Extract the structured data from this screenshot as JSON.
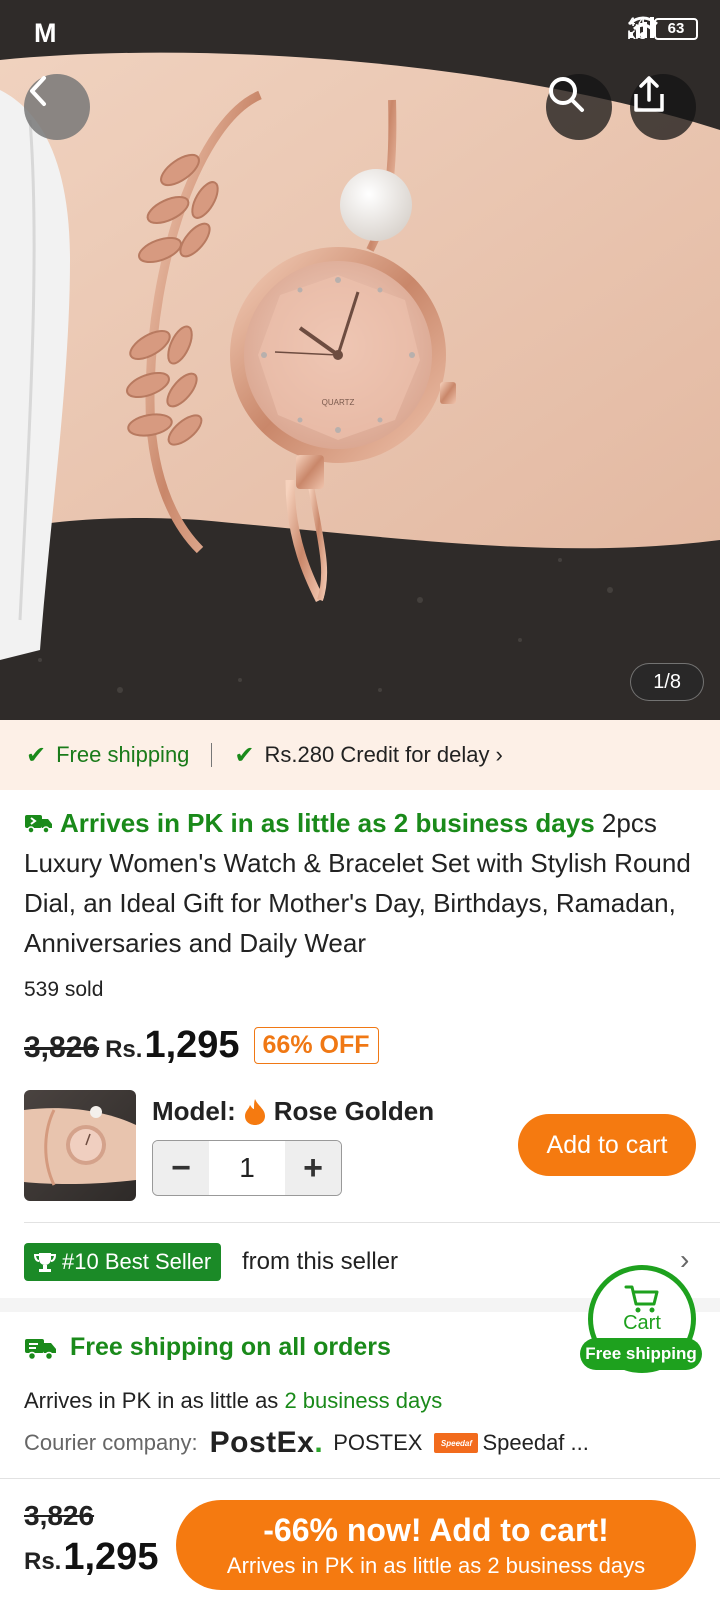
{
  "status_bar": {
    "time": "M",
    "speed_top": "4.4",
    "speed_bottom": "K/s",
    "battery": "63"
  },
  "gallery": {
    "page_indicator": "1/8",
    "watch_dial_text": "QUARTZ"
  },
  "shipping_strip": {
    "free_shipping": "Free shipping",
    "credit": "Rs.280 Credit for delay"
  },
  "product": {
    "arrives_badge": "Arrives in PK in as little as 2 business days",
    "title": " 2pcs Luxury Women's Watch & Bracelet Set with Stylish Round Dial, an Ideal Gift for Mother's Day, Birthdays, Ramadan, Anniversaries and Daily Wear",
    "sold": "539 sold",
    "old_price": "3,826",
    "currency": "Rs.",
    "price": "1,295",
    "discount": "66% OFF"
  },
  "variant": {
    "model_label": "Model:",
    "model_value": "Rose Golden",
    "quantity": "1",
    "minus": "−",
    "plus": "+",
    "add_to_cart": "Add to cart"
  },
  "seller": {
    "best_seller_badge": "#10 Best Seller",
    "from_seller": "from this seller"
  },
  "delivery": {
    "free_shipping_all": "Free shipping on all orders",
    "arrives_prefix": "Arrives in PK in as little as ",
    "arrives_days": "2 business days",
    "courier_label": "Courier company:",
    "postex_logo": "PostEx",
    "postex_name": "POSTEX",
    "speedaf_logo": "Speedaf",
    "speedaf_name": "Speedaf ..."
  },
  "floating_cart": {
    "label": "Cart",
    "tag": "Free shipping"
  },
  "bottom_bar": {
    "old_price": "3,826",
    "currency": "Rs.",
    "price": "1,295",
    "cta_main": "-66% now! Add to cart!",
    "cta_sub": "Arrives in PK in as little as 2 business days"
  },
  "colors": {
    "accent_orange": "#f57a10",
    "green": "#1a8a1a",
    "strip_bg": "#fdf0e7"
  }
}
